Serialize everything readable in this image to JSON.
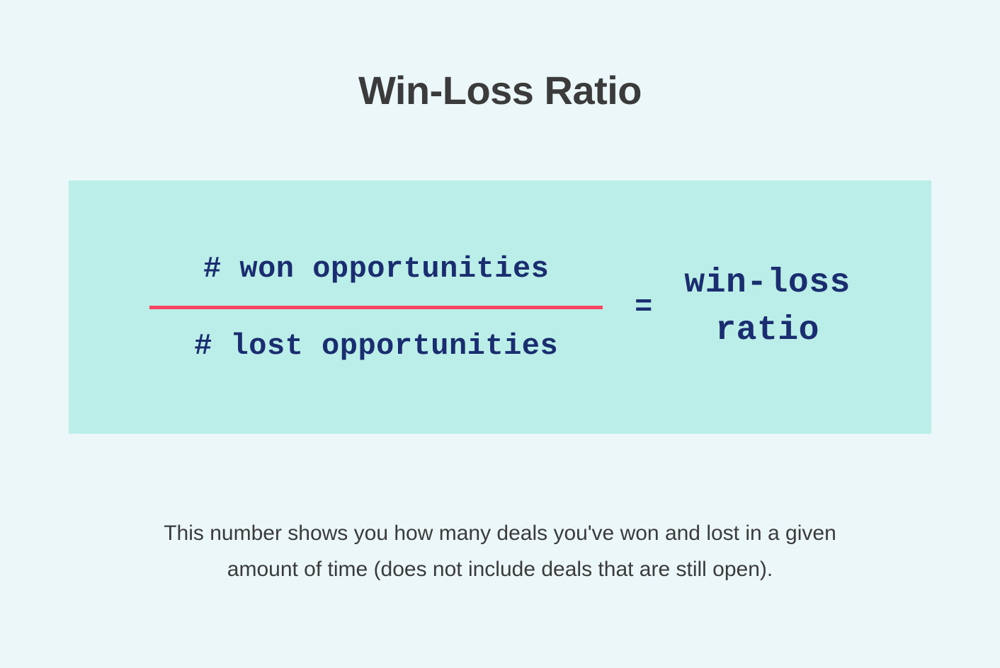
{
  "title": "Win-Loss Ratio",
  "formula": {
    "numerator": "# won opportunities",
    "denominator": "# lost opportunities",
    "equals": "=",
    "result_line1": "win-loss",
    "result_line2": "ratio"
  },
  "description": "This number shows you how many deals you've won and lost in a given amount of time (does not include deals that are still open).",
  "colors": {
    "background": "#ebf7f8",
    "formula_box_bg": "#bbeee8",
    "formula_text": "#1a2d6e",
    "fraction_bar": "#fb4560",
    "title_text": "#3b3b3b",
    "description_text": "#3b3b3b"
  }
}
